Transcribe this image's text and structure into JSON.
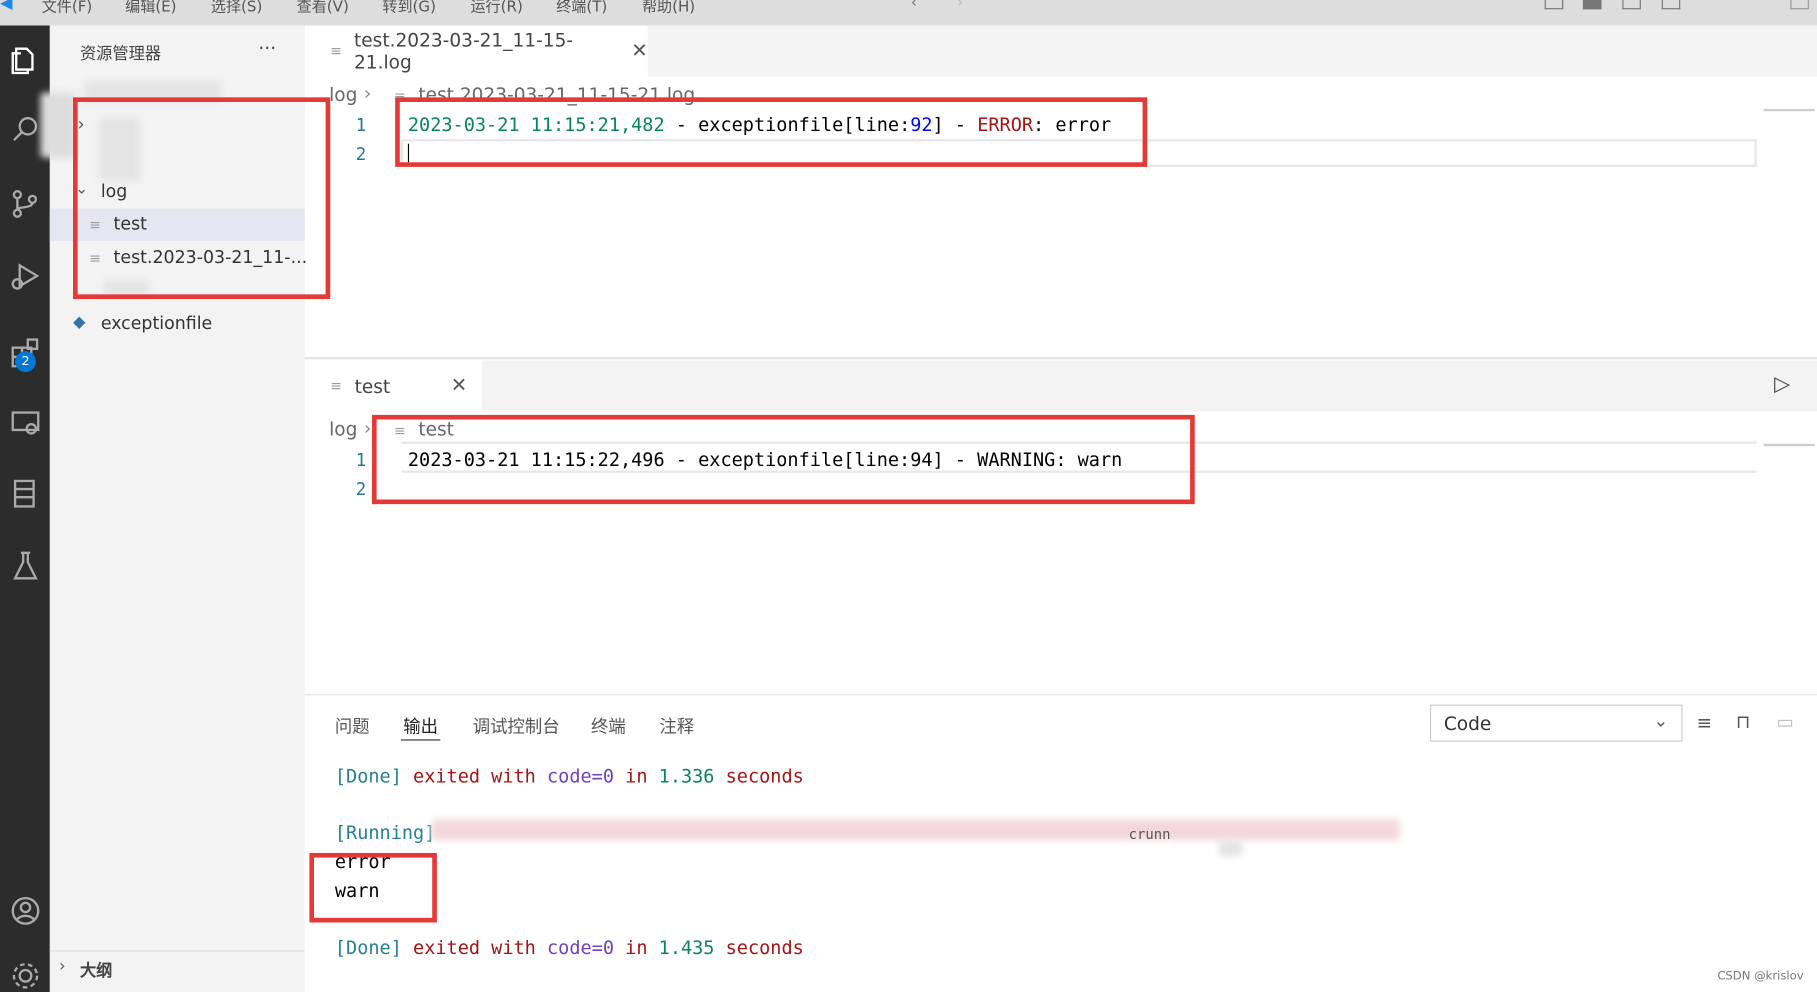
{
  "menu": [
    "文件(F)",
    "编辑(E)",
    "选择(S)",
    "查看(V)",
    "转到(G)",
    "运行(R)",
    "终端(T)",
    "帮助(H)"
  ],
  "explorer": {
    "title": "资源管理器",
    "more": "···",
    "folder_log": "log",
    "files": [
      "test",
      "test.2023-03-21_11-..."
    ],
    "py_file": "exceptionfile",
    "outline": "大纲",
    "extensions_badge": "2"
  },
  "editor_top": {
    "tab_label": "test.2023-03-21_11-15-21.log",
    "breadcrumb_folder": "log",
    "breadcrumb_file": "test.2023-03-21_11-15-21.log",
    "line_numbers": [
      "1",
      "2"
    ],
    "line1": {
      "date": "2023-03-21 11:15:21,482",
      "sep1": " - ",
      "module": "exceptionfile[line:",
      "lineno": "92",
      "close": "]",
      "sep2": " - ",
      "level": "ERROR",
      "colon": ": ",
      "msg": "error"
    }
  },
  "editor_bottom": {
    "tab_label": "test",
    "breadcrumb_folder": "log",
    "breadcrumb_file": "test",
    "line_numbers": [
      "1",
      "2"
    ],
    "line1": "2023-03-21 11:15:22,496 - exceptionfile[line:94] - WARNING: warn"
  },
  "panel": {
    "tabs": [
      "问题",
      "输出",
      "调试控制台",
      "终端",
      "注释"
    ],
    "active_tab": "输出",
    "dropdown_value": "Code",
    "output": {
      "done1": {
        "tag": "[Done]",
        "exited": "exited",
        "with": "with",
        "code": "code=0",
        "in": "in",
        "time": "1.336",
        "seconds": "seconds"
      },
      "running": "[Running]",
      "running_tail": "crunn",
      "line_error": "error",
      "line_warn": "warn",
      "done2": {
        "tag": "[Done]",
        "exited": "exited",
        "with": "with",
        "code": "code=0",
        "in": "in",
        "time": "1.435",
        "seconds": "seconds"
      }
    }
  },
  "watermark": "CSDN @krislov",
  "colors": {
    "highlight_box": "#e53935",
    "activity_bar": "#2c2c2c",
    "date_green": "#098658",
    "error_red": "#a31515",
    "number_blue": "#0000ff",
    "done_blue": "#267f99",
    "keyword_red": "#a31515",
    "keyword_purple": "#6f42c1"
  }
}
